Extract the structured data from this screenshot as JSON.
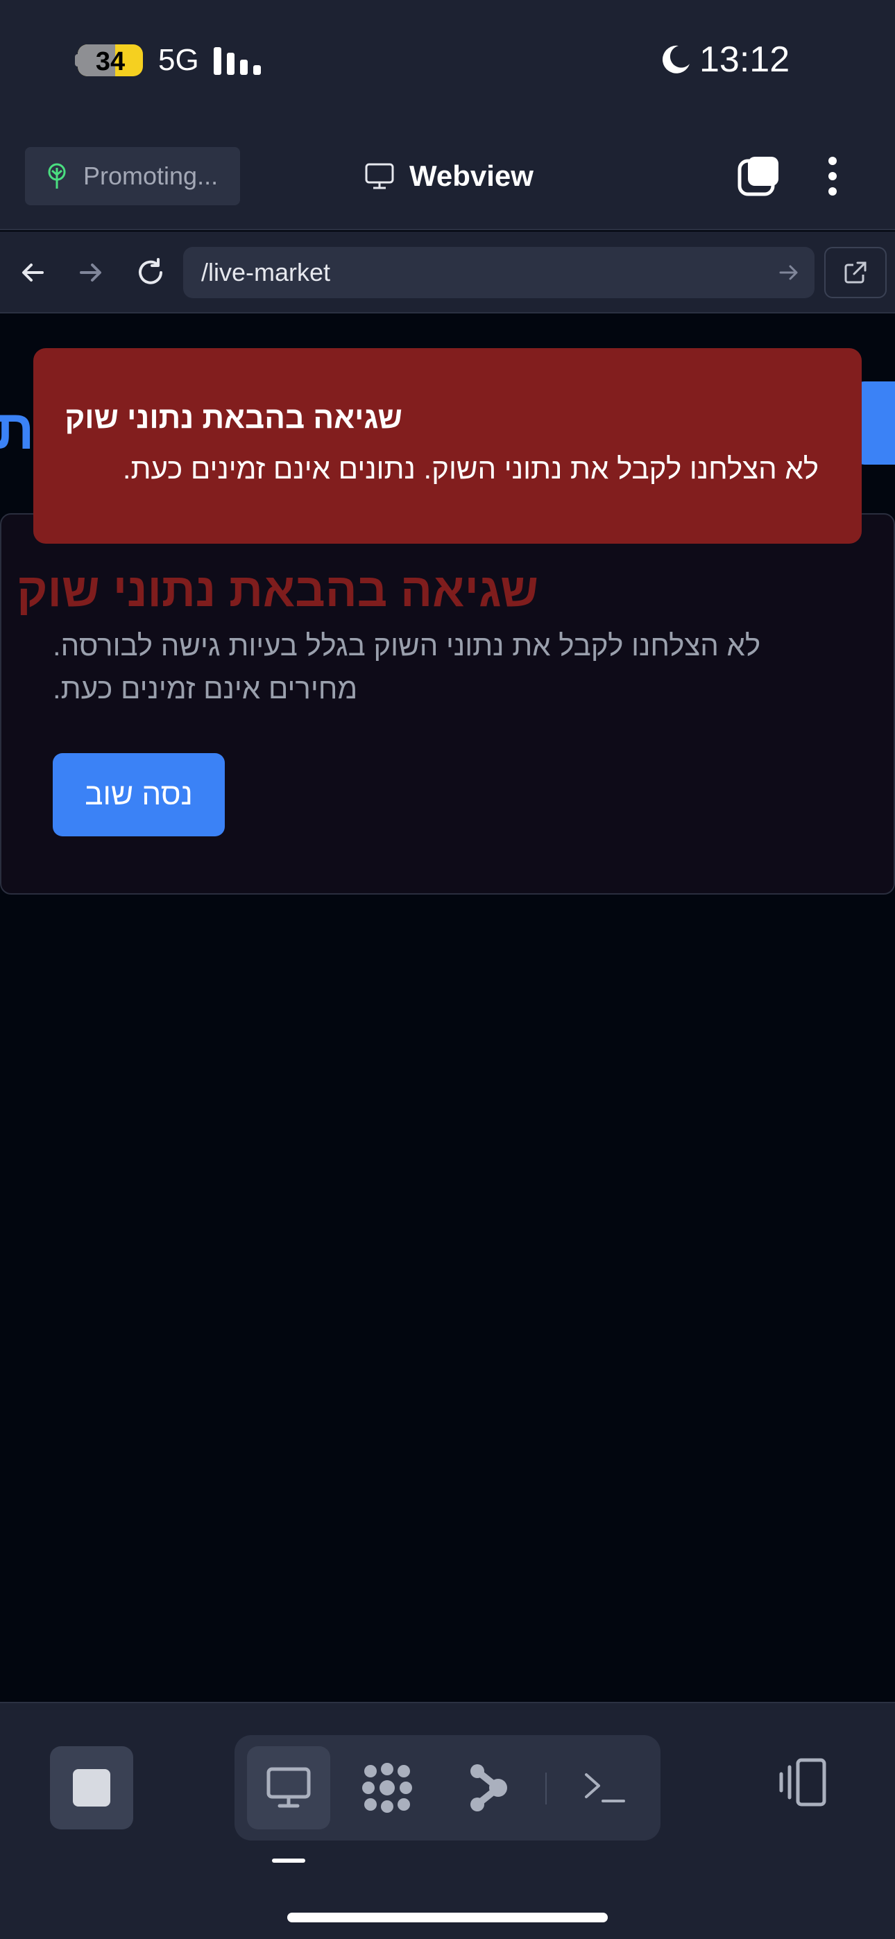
{
  "status_bar": {
    "battery": "34",
    "battery_level": 0.34,
    "network": "5G",
    "time": "13:12",
    "icons": [
      "battery-icon",
      "signal-icon",
      "moon-icon"
    ]
  },
  "header": {
    "promo_label": "Promoting...",
    "title": "Webview",
    "icons": [
      "tree-icon",
      "monitor-icon",
      "tabs-icon",
      "more-vertical-icon"
    ]
  },
  "navbar": {
    "url": "/live-market",
    "icons": [
      "arrow-left-icon",
      "arrow-right-icon",
      "reload-icon",
      "go-arrow-icon",
      "external-link-icon"
    ]
  },
  "page": {
    "heading_fragment": "ת",
    "error_card": {
      "title": "שגיאה בהבאת נתוני שוק",
      "message": "לא הצלחנו לקבל את נתוני השוק בגלל בעיות גישה לבורסה. מחירים אינם זמינים כעת.",
      "retry_label": "נסה שוב"
    },
    "toast": {
      "title": "שגיאה בהבאת נתוני שוק",
      "message": "לא הצלחנו לקבל את נתוני השוק. נתונים אינם זמינים כעת."
    }
  },
  "bottom_toolbar": {
    "icons": [
      "stop-icon",
      "monitor-icon",
      "grid-dots-icon",
      "share-nodes-icon",
      "terminal-icon",
      "device-rotate-icon"
    ],
    "active_tab": "monitor",
    "colors": {
      "accent": "#3b82f6",
      "error_bg": "#821e1e",
      "error_title": "#7f1d1d"
    }
  }
}
